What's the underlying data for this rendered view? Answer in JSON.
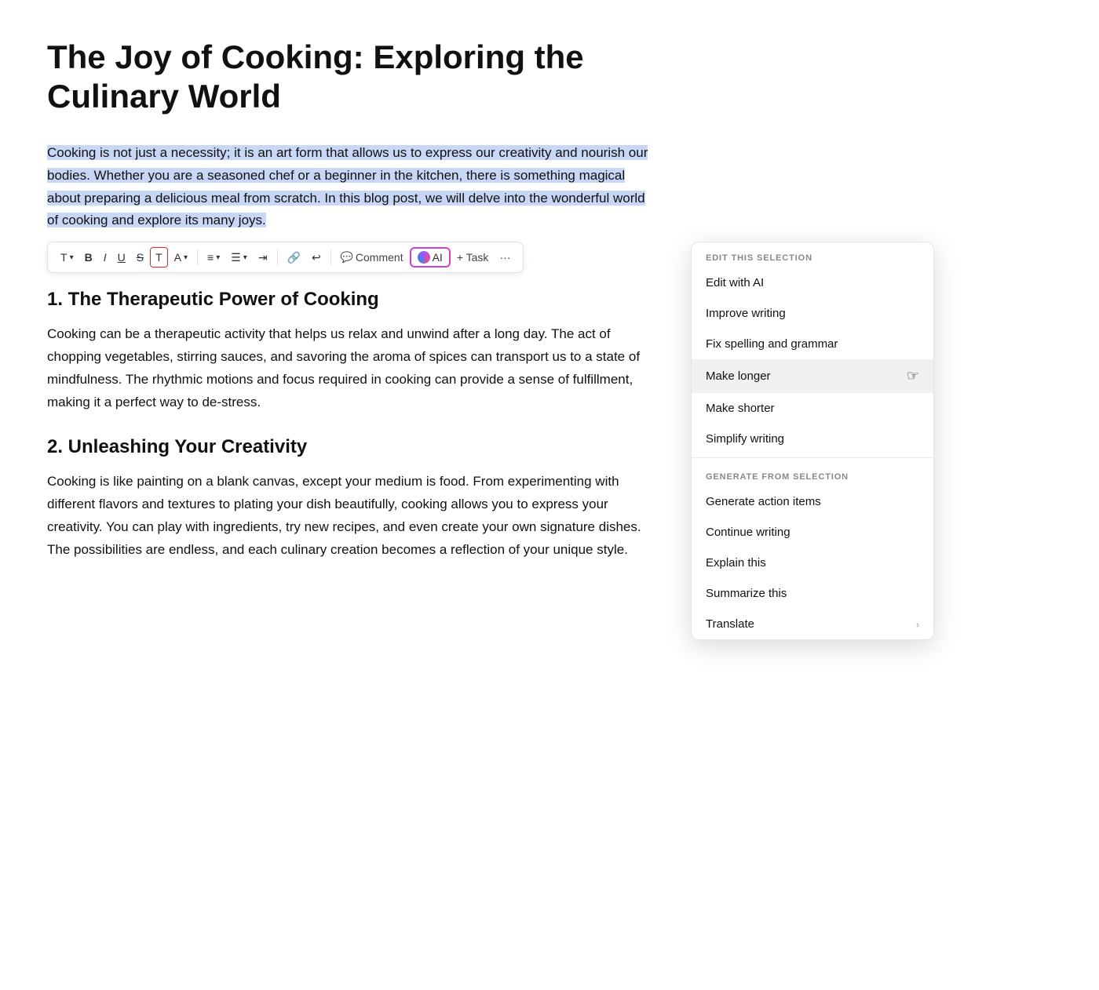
{
  "document": {
    "title": "The Joy of Cooking: Exploring the Culinary World",
    "intro": "Cooking is not just a necessity; it is an art form that allows us to express our creativity and nourish our bodies. Whether you are a seasoned chef or a beginner in the kitchen, there is something magical about preparing a delicious meal from scratch. In this blog post, we will delve into the wonderful world of cooking and explore its many joys.",
    "section1": {
      "heading": "1. The Therapeutic Power of Cooking",
      "body": "Cooking can be a therapeutic activity that helps us relax and unwind after a long day. The act of chopping vegetables, stirring sauces, and savoring the aroma of spices can transport us to a state of mindfulness. The rhythmic motions and focus required in cooking can provide a sense of fulfillment, making it a perfect way to de-stress."
    },
    "section2": {
      "heading": "2. Unleashing Your Creativity",
      "body": "Cooking is like painting on a blank canvas, except your medium is food. From experimenting with different flavors and textures to plating your dish beautifully, cooking allows you to express your creativity. You can play with ingredients, try new recipes, and even create your own signature dishes. The possibilities are endless, and each culinary creation becomes a reflection of your unique style."
    }
  },
  "toolbar": {
    "text_btn": "T",
    "bold_btn": "B",
    "italic_btn": "I",
    "underline_btn": "U",
    "strikethrough_btn": "S",
    "highlight_btn": "T",
    "font_color_btn": "A",
    "align_btn": "≡",
    "list_btn": "☰",
    "indent_btn": "⇥",
    "link_btn": "🔗",
    "undo_btn": "↩",
    "comment_btn": "Comment",
    "ai_btn": "AI",
    "task_btn": "+ Task",
    "more_btn": "···"
  },
  "ai_menu": {
    "edit_section_label": "EDIT THIS SELECTION",
    "generate_section_label": "GENERATE FROM SELECTION",
    "items_edit": [
      {
        "label": "Edit with AI",
        "has_arrow": false
      },
      {
        "label": "Improve writing",
        "has_arrow": false
      },
      {
        "label": "Fix spelling and grammar",
        "has_arrow": false
      },
      {
        "label": "Make longer",
        "has_arrow": false,
        "hovered": true
      },
      {
        "label": "Make shorter",
        "has_arrow": false
      },
      {
        "label": "Simplify writing",
        "has_arrow": false
      }
    ],
    "items_generate": [
      {
        "label": "Generate action items",
        "has_arrow": false
      },
      {
        "label": "Continue writing",
        "has_arrow": false
      },
      {
        "label": "Explain this",
        "has_arrow": false
      },
      {
        "label": "Summarize this",
        "has_arrow": false
      },
      {
        "label": "Translate",
        "has_arrow": true
      }
    ]
  }
}
